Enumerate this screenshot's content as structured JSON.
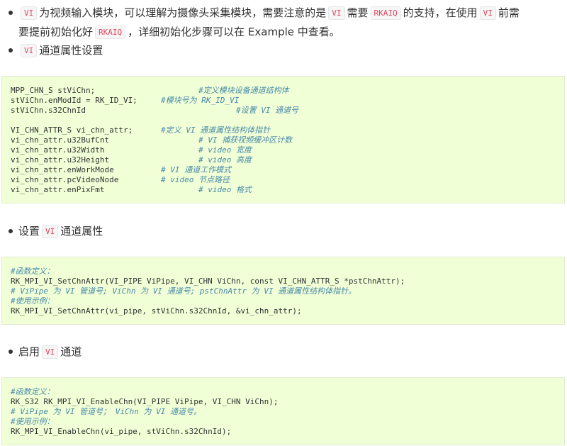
{
  "section_intro": {
    "line1": {
      "p1": "为视频输入模块，可以理解为摄像头采集模块，需要注意的是",
      "p2": "需要",
      "p3": "的支持，在使用",
      "p4": "前需",
      "tag_vi": "VI",
      "tag_rkaiq": "RKAIQ"
    },
    "line2": {
      "p1": "要提前初始化好",
      "p2": "，详细初始化步骤可以在 Example 中查看。",
      "tag_rkaiq": "RKAIQ"
    }
  },
  "bullet_attr": {
    "tag": "VI",
    "text": "通道属性设置"
  },
  "code1": {
    "lines": [
      {
        "code": "MPP_CHN_S stViChn;",
        "comment": "#定义模块设备通道结构体"
      },
      {
        "code": "stViChn.enModId = RK_ID_VI;",
        "comment": "#模块号为 RK_ID_VI"
      },
      {
        "code": "stViChn.s32ChnId",
        "comment": "#设置 VI 通道号"
      },
      {
        "code": "",
        "comment": ""
      },
      {
        "code": "VI_CHN_ATTR_S vi_chn_attr;",
        "comment": "#定义 VI 通道属性结构体指针"
      },
      {
        "code": "vi_chn_attr.u32BufCnt",
        "comment": "# VI 捕获视频缓冲区计数"
      },
      {
        "code": "vi_chn_attr.u32Width",
        "comment": "# video 宽度"
      },
      {
        "code": "vi_chn_attr.u32Height",
        "comment": "# video 高度"
      },
      {
        "code": "vi_chn_attr.enWorkMode",
        "comment": "# VI 通道工作模式"
      },
      {
        "code": "vi_chn_attr.pcVideoNode",
        "comment": "# video 节点路径"
      },
      {
        "code": "vi_chn_attr.enPixFmt",
        "comment": "# video 格式"
      }
    ]
  },
  "bullet_set": {
    "p1": "设置",
    "tag": "VI",
    "p2": "通道属性"
  },
  "code2": {
    "lines": [
      {
        "code": "",
        "comment": "#函数定义："
      },
      {
        "code": "RK_MPI_VI_SetChnAttr(VI_PIPE ViPipe, VI_CHN ViChn, const VI_CHN_ATTR_S *pstChnAttr);",
        "comment": ""
      },
      {
        "code": "",
        "comment": "# ViPipe 为 VI 管道号; ViChn 为 VI 通道号; pstChnAttr 为 VI 通道属性结构体指针。"
      },
      {
        "code": "",
        "comment": "#使用示例："
      },
      {
        "code": "RK_MPI_VI_SetChnAttr(vi_pipe, stViChn.s32ChnId, &vi_chn_attr);",
        "comment": ""
      }
    ]
  },
  "bullet_enable": {
    "p1": "启用",
    "tag": "VI",
    "p2": "通道"
  },
  "code3": {
    "lines": [
      {
        "code": "",
        "comment": "#函数定义："
      },
      {
        "code": "RK_S32 RK_MPI_VI_EnableChn(VI_PIPE ViPipe, VI_CHN ViChn);",
        "comment": ""
      },
      {
        "code": "",
        "comment": "# ViPipe 为 VI 管道号； ViChn 为 VI 通道号。"
      },
      {
        "code": "",
        "comment": "#使用示例："
      },
      {
        "code": "RK_MPI_VI_EnableChn(vi_pipe, stViChn.s32ChnId);",
        "comment": ""
      }
    ]
  }
}
